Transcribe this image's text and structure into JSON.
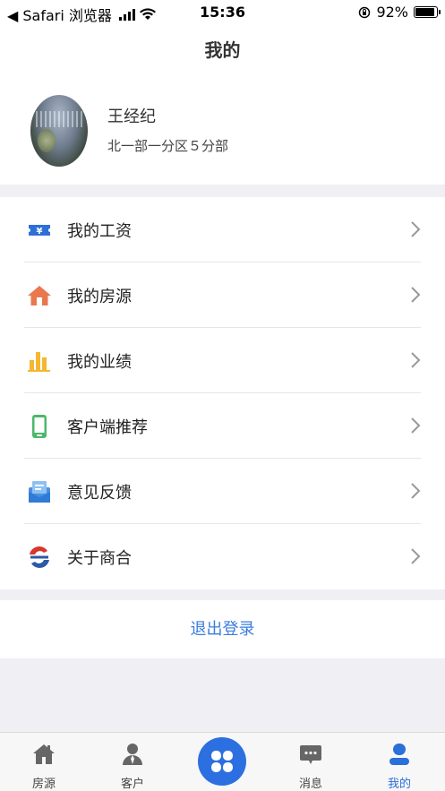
{
  "status_bar": {
    "back_app": "◀ Safari 浏览器",
    "time": "15:36",
    "battery_text": "92%",
    "battery_level": 0.92
  },
  "nav": {
    "title": "我的"
  },
  "profile": {
    "name": "王经纪",
    "department": "北一部一分区５分部"
  },
  "menu": {
    "items": [
      {
        "label": "我的工资",
        "icon": "salary-ticket-icon",
        "color": "#2e6fd8"
      },
      {
        "label": "我的房源",
        "icon": "house-icon",
        "color": "#e9784f"
      },
      {
        "label": "我的业绩",
        "icon": "bar-chart-icon",
        "color": "#f3b731"
      },
      {
        "label": "客户端推荐",
        "icon": "phone-icon",
        "color": "#4cb86a"
      },
      {
        "label": "意见反馈",
        "icon": "feedback-mail-icon",
        "color": "#4a90e2"
      },
      {
        "label": "关于商合",
        "icon": "brand-logo-icon",
        "color": "#d8362a"
      }
    ]
  },
  "logout": {
    "label": "退出登录",
    "color": "#3b7ddc"
  },
  "tab_bar": {
    "tabs": [
      {
        "label": "房源",
        "icon": "house-tab-icon"
      },
      {
        "label": "客户",
        "icon": "person-tab-icon"
      },
      {
        "label": "",
        "icon": "clover-center-icon"
      },
      {
        "label": "消息",
        "icon": "message-bubble-icon"
      },
      {
        "label": "我的",
        "icon": "user-tab-icon",
        "active": true
      }
    ],
    "active_color": "#2b6fd8"
  }
}
